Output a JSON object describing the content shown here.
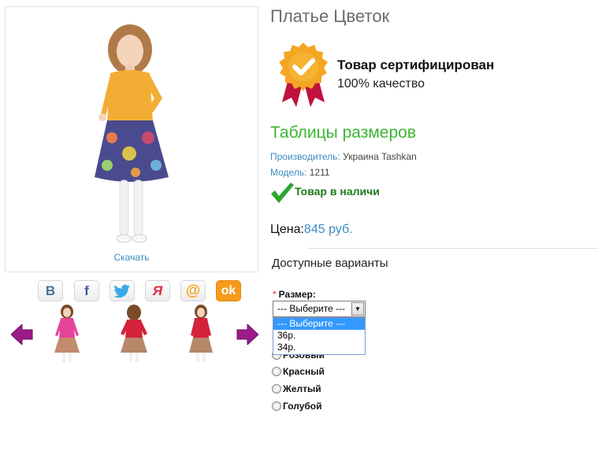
{
  "product": {
    "title": "Платье Цветок",
    "download_label": "Скачать"
  },
  "certificate": {
    "title": "Товар сертифицирован",
    "subtitle": "100% качество"
  },
  "size_tables_link": "Таблицы размеров",
  "manufacturer": {
    "label": "Производитель:",
    "value": "Украина Tashkan"
  },
  "model": {
    "label": "Модель:",
    "value": "1211"
  },
  "stock_status": "Товар в наличи",
  "price": {
    "label": "Цена:",
    "value": "845 руб."
  },
  "options": {
    "heading": "Доступные варианты",
    "size": {
      "required_mark": "*",
      "label": "Размер:",
      "selected": "--- Выберите ---",
      "dropdown_options": [
        "--- Выберите ---",
        "36р.",
        "34р."
      ]
    },
    "colors": [
      {
        "label": "Розовый",
        "partially_hidden": true
      },
      {
        "label": "Красный"
      },
      {
        "label": "Желтый"
      },
      {
        "label": "Голубой"
      }
    ]
  },
  "social_icons": [
    "vk-icon",
    "facebook-icon",
    "twitter-icon",
    "moimir-icon",
    "mailru-icon",
    "odnoklassniki-icon"
  ],
  "colors": {
    "link_blue": "#3b8bbf",
    "green_title": "#3cb531",
    "stock_green": "#1f7a1f",
    "dropdown_highlight": "#3399ff",
    "arrow_purple": "#9b1b8a"
  }
}
